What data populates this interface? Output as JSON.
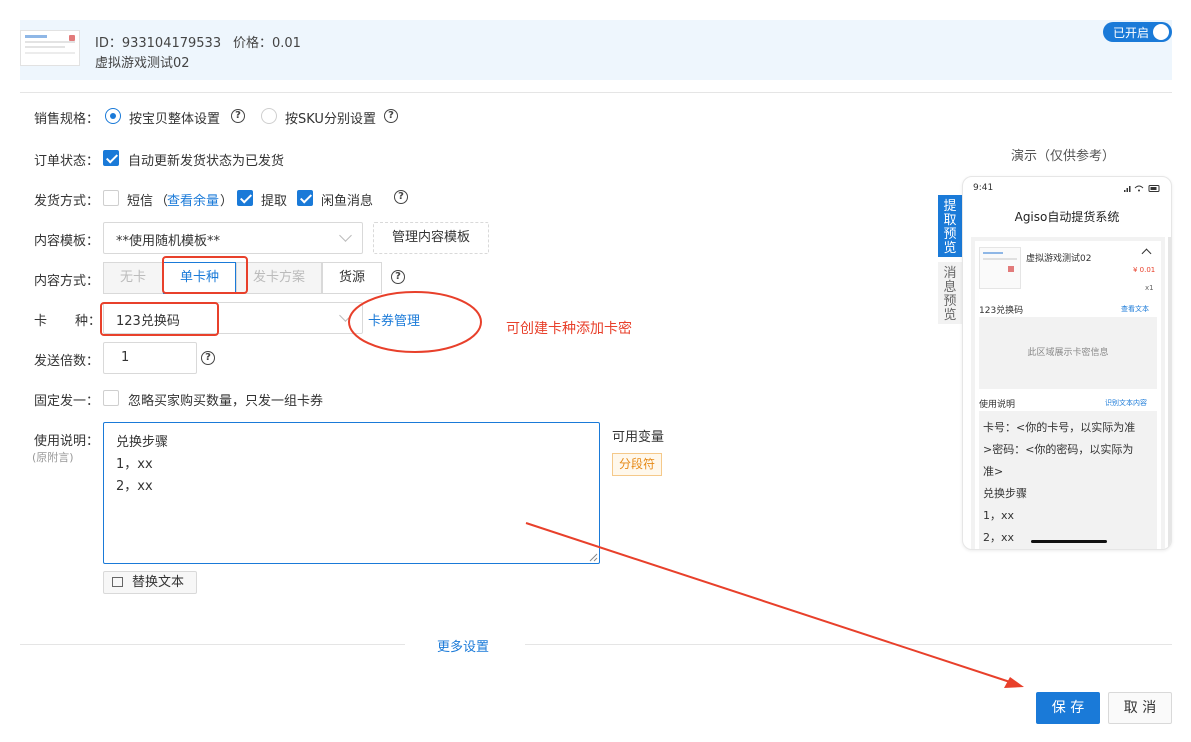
{
  "header": {
    "id_text": "ID：933104179533",
    "price_text": "价格：0.01",
    "product_name": "虚拟游戏测试02",
    "toggle_label": "已开启"
  },
  "form": {
    "sales_spec": {
      "label": "销售规格：",
      "option1": "按宝贝整体设置",
      "option2": "按SKU分别设置",
      "selected": "按宝贝整体设置"
    },
    "order_status": {
      "label": "订单状态：",
      "checkbox_label": "自动更新发货状态为已发货",
      "checked": true
    },
    "delivery_method": {
      "label": "发货方式：",
      "sms_label": "短信",
      "sms_link_open": "（",
      "sms_link": "查看余量",
      "sms_link_close": "）",
      "pickup_label": "提取",
      "xianyu_label": "闲鱼消息",
      "sms_checked": false,
      "pickup_checked": true,
      "xianyu_checked": true
    },
    "content_template": {
      "label": "内容模板：",
      "value": "**使用随机模板**",
      "manage_button": "管理内容模板"
    },
    "content_method": {
      "label": "内容方式：",
      "options": [
        "无卡",
        "单卡种",
        "发卡方案",
        "货源"
      ],
      "selected": "单卡种"
    },
    "card_type": {
      "label_char1": "卡",
      "label_char2": "种：",
      "value": "123兑换码",
      "manage_link": "卡券管理",
      "annotation": "可创建卡种添加卡密"
    },
    "send_multiplier": {
      "label": "发送倍数：",
      "value": "1"
    },
    "fixed_one": {
      "label": "固定发一：",
      "checkbox_label": "忽略买家购买数量，只发一组卡券",
      "checked": false
    },
    "instructions": {
      "label": "使用说明：",
      "sublabel": "(原附言)",
      "lines": [
        "兑换步骤",
        "1，xx",
        "2，xx"
      ],
      "variables_label": "可用变量",
      "separator_tag": "分段符",
      "replace_button": "替换文本"
    },
    "more_settings": "更多设置",
    "save_button": "保 存",
    "cancel_button": "取 消"
  },
  "preview": {
    "title": "演示（仅供参考）",
    "tab_active": "提取预览",
    "tab_inactive": "消息预览",
    "phone_time": "9:41",
    "app_title": "Agiso自动提货系统",
    "item_name": "虚拟游戏测试02",
    "item_price": "¥ 0.01",
    "item_qty": "x1",
    "card_name": "123兑换码",
    "view_text_link": "查看文本",
    "card_area_text": "此区域展示卡密信息",
    "usage_label": "使用说明",
    "recognize_link": "识别文本内容",
    "usage_lines": [
      "卡号：<你的卡号，以实际为准",
      ">密码：<你的密码，以实际为",
      "准>",
      "兑换步骤",
      "1，xx",
      "2，xx"
    ]
  },
  "colors": {
    "accent": "#1a7ad8",
    "annotation_red": "#e8402b"
  }
}
